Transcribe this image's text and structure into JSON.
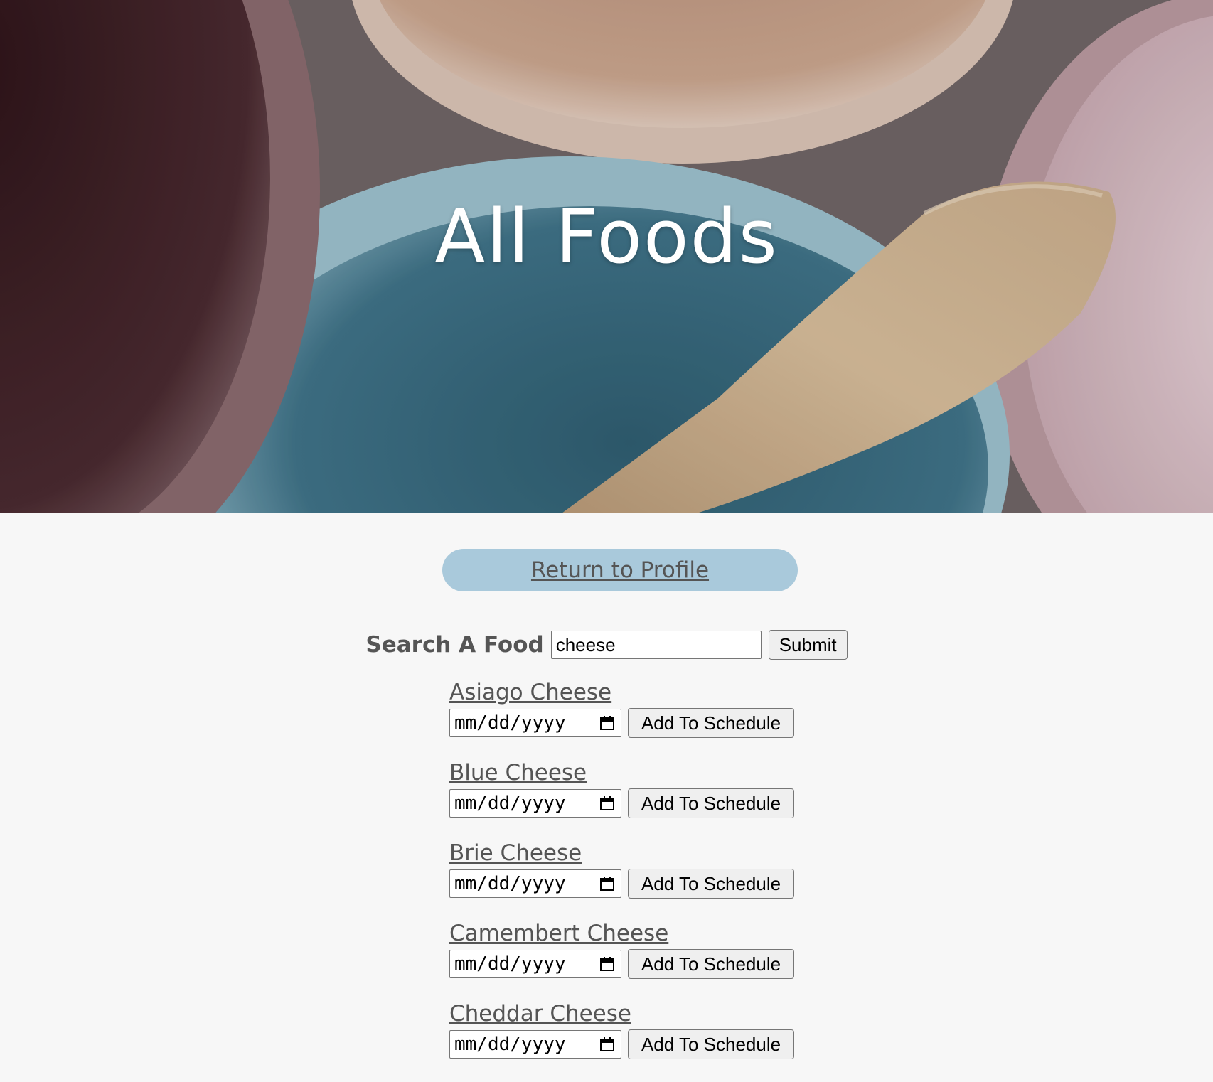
{
  "page": {
    "title": "All Foods"
  },
  "nav": {
    "return_label": "Return to Profile"
  },
  "search": {
    "label": "Search A Food",
    "value": "cheese",
    "submit_label": "Submit"
  },
  "foods": [
    {
      "name": "Asiago Cheese",
      "date_placeholder": "mm/dd/yyyy",
      "add_label": "Add To Schedule"
    },
    {
      "name": "Blue Cheese",
      "date_placeholder": "mm/dd/yyyy",
      "add_label": "Add To Schedule"
    },
    {
      "name": "Brie Cheese",
      "date_placeholder": "mm/dd/yyyy",
      "add_label": "Add To Schedule"
    },
    {
      "name": "Camembert Cheese",
      "date_placeholder": "mm/dd/yyyy",
      "add_label": "Add To Schedule"
    },
    {
      "name": "Cheddar Cheese",
      "date_placeholder": "mm/dd/yyyy",
      "add_label": "Add To Schedule"
    }
  ],
  "colors": {
    "background": "#f7f7f7",
    "return_button": "#a9c9db",
    "text": "#555555"
  },
  "icons": {
    "date_picker": "calendar-icon"
  }
}
